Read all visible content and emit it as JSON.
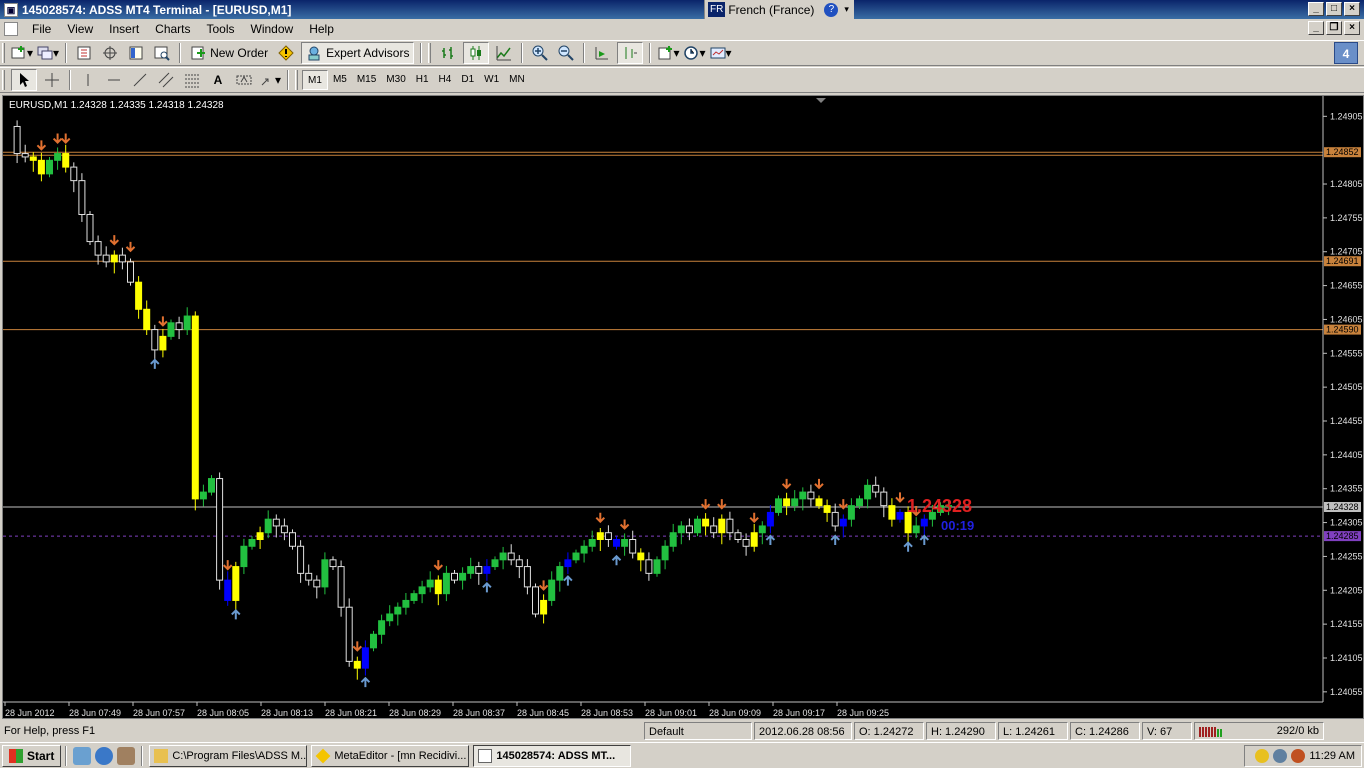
{
  "window": {
    "title": "145028574: ADSS MT4 Terminal - [EURUSD,M1]",
    "language_code": "FR",
    "language_name": "French (France)"
  },
  "menu": [
    "File",
    "View",
    "Insert",
    "Charts",
    "Tools",
    "Window",
    "Help"
  ],
  "toolbar": {
    "new_order": "New Order",
    "expert_advisors": "Expert Advisors",
    "timeframes": [
      "M1",
      "M5",
      "M15",
      "M30",
      "H1",
      "H4",
      "D1",
      "W1",
      "MN"
    ],
    "active_timeframe": "M1",
    "notification_count": "4"
  },
  "chart": {
    "header": "EURUSD,M1  1.24328 1.24335 1.24318 1.24328",
    "bid_price": "1.24328",
    "countdown": "00:19",
    "price_ticks": [
      "1.24905",
      "1.24805",
      "1.24755",
      "1.24705",
      "1.24655",
      "1.24605",
      "1.24555",
      "1.24505",
      "1.24455",
      "1.24405",
      "1.24355",
      "1.24305",
      "1.24255",
      "1.24205",
      "1.24155",
      "1.24105",
      "1.24055"
    ],
    "time_ticks": [
      "28 Jun 2012",
      "28 Jun 07:49",
      "28 Jun 07:57",
      "28 Jun 08:05",
      "28 Jun 08:13",
      "28 Jun 08:21",
      "28 Jun 08:29",
      "28 Jun 08:37",
      "28 Jun 08:45",
      "28 Jun 08:53",
      "28 Jun 09:01",
      "28 Jun 09:09",
      "28 Jun 09:17",
      "28 Jun 09:25"
    ],
    "horizontal_levels": [
      {
        "price": 1.24852,
        "label": "1.24852",
        "color": "#c8823c"
      },
      {
        "price": 1.24691,
        "label": "1.24691",
        "color": "#c8823c"
      },
      {
        "price": 1.2459,
        "label": "1.24590",
        "color": "#c8823c"
      },
      {
        "price": 1.24328,
        "label": "1.24328",
        "color": "#c0c0c0"
      },
      {
        "price": 1.24285,
        "label": "1.24285",
        "color": "#8040c0"
      }
    ],
    "colors": {
      "background": "#000000",
      "bull_candle": "#22c040",
      "bear_candle": "#e0e0e0",
      "signal_bar_yellow": "#ffff00",
      "signal_bar_blue": "#0000ff",
      "down_arrow": "#e07030",
      "up_arrow": "#6a9ad0",
      "bid_label": "#e02020",
      "countdown": "#2020e0"
    }
  },
  "status": {
    "help": "For Help, press F1",
    "profile": "Default",
    "datetime": "2012.06.28 08:56",
    "open": "O: 1.24272",
    "high": "H: 1.24290",
    "low": "L: 1.24261",
    "close": "C: 1.24286",
    "volume": "V: 67",
    "traffic": "292/0 kb"
  },
  "taskbar": {
    "start": "Start",
    "tasks": [
      "C:\\Program Files\\ADSS M...",
      "MetaEditor - [mn Recidivi...",
      "145028574: ADSS MT..."
    ],
    "clock": "11:29 AM"
  }
}
